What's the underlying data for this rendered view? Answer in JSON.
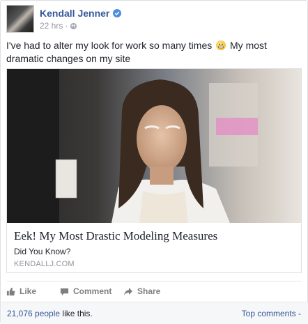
{
  "post": {
    "author": "Kendall Jenner",
    "timestamp": "22 hrs",
    "separator": "·",
    "text_part1": "I've had to alter my look for work so many times",
    "text_part2": "My most dramatic changes on my site",
    "emoji_name": "grimacing-face"
  },
  "link": {
    "title": "Eek! My Most Drastic Modeling Measures",
    "description": "Did You Know?",
    "domain": "KENDALLJ.COM"
  },
  "actions": {
    "like": "Like",
    "comment": "Comment",
    "share": "Share"
  },
  "footer": {
    "like_count": "21,076 people",
    "like_suffix": "like this.",
    "top_comments": "Top comments -"
  },
  "colors": {
    "author_link": "#365899",
    "verified_badge": "#4d8ee0",
    "meta_gray": "#90949c"
  }
}
